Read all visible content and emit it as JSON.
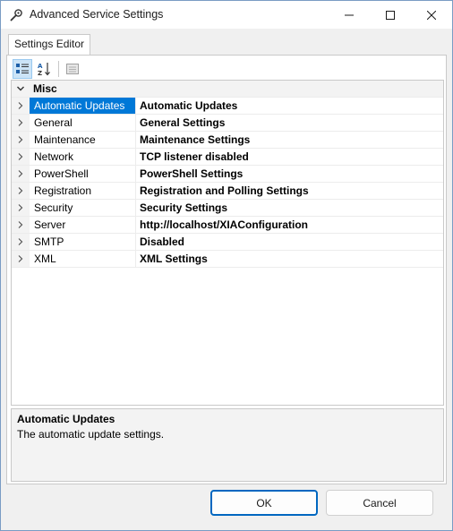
{
  "window": {
    "title": "Advanced Service Settings",
    "icon": "wrench-icon"
  },
  "tabs": [
    {
      "label": "Settings Editor",
      "selected": true
    }
  ],
  "toolbar": {
    "categorized_icon": "categorized-view-icon",
    "alphabetical_icon": "sort-alphabetical-icon",
    "property_pages_icon": "property-pages-icon"
  },
  "grid": {
    "category": "Misc",
    "rows": [
      {
        "name": "Automatic Updates",
        "value": "Automatic Updates",
        "selected": true
      },
      {
        "name": "General",
        "value": "General Settings"
      },
      {
        "name": "Maintenance",
        "value": "Maintenance Settings"
      },
      {
        "name": "Network",
        "value": "TCP listener disabled"
      },
      {
        "name": "PowerShell",
        "value": "PowerShell Settings"
      },
      {
        "name": "Registration",
        "value": "Registration and Polling Settings"
      },
      {
        "name": "Security",
        "value": "Security Settings"
      },
      {
        "name": "Server",
        "value": "http://localhost/XIAConfiguration"
      },
      {
        "name": "SMTP",
        "value": "Disabled"
      },
      {
        "name": "XML",
        "value": "XML Settings"
      }
    ]
  },
  "description": {
    "title": "Automatic Updates",
    "text": "The automatic update settings."
  },
  "buttons": {
    "ok": "OK",
    "cancel": "Cancel"
  },
  "colors": {
    "selection": "#0078d7",
    "primary_border": "#0067c0"
  }
}
